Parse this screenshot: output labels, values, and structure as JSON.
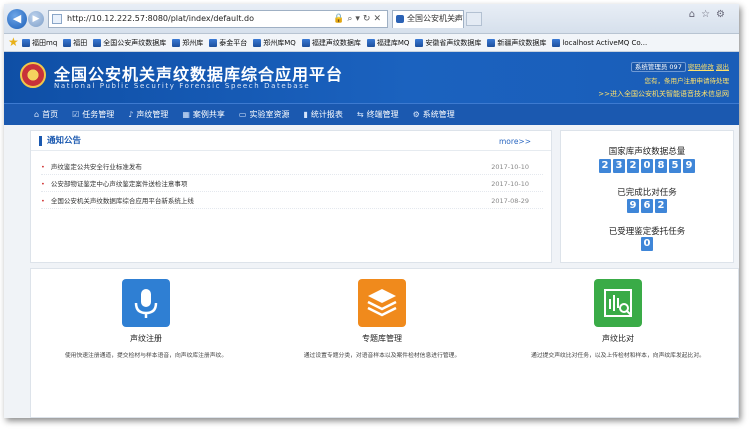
{
  "browser": {
    "url": "http://10.12.222.57:8080/plat/index/default.do",
    "tab_title": "全国公安机关声纹...",
    "favorites": [
      "福田mq",
      "福田",
      "全国公安声纹数据库",
      "郑州库",
      "泰金平台",
      "郑州库MQ",
      "福建声纹数据库",
      "福建库MQ",
      "安徽省声纹数据库",
      "新疆声纹数据库",
      "localhost ActiveMQ Co..."
    ]
  },
  "site": {
    "title": "全国公安机关声纹数据库综合应用平台",
    "subtitle": "National Public Security Forensic Speech Datebase",
    "user": {
      "name": "系统管理员 097",
      "change_password": "密码修改",
      "logout": "退出",
      "welcome": "您有，条用户注册申请待处理",
      "entry": ">>进入全国公安机关智能语音技术信息网"
    }
  },
  "nav": {
    "items": [
      {
        "icon": "⌂",
        "label": "首页"
      },
      {
        "icon": "☑",
        "label": "任务管理"
      },
      {
        "icon": "♪",
        "label": "声纹管理"
      },
      {
        "icon": "▦",
        "label": "案例共享"
      },
      {
        "icon": "▭",
        "label": "实验室资源"
      },
      {
        "icon": "▮",
        "label": "统计报表"
      },
      {
        "icon": "⇆",
        "label": "终端管理"
      },
      {
        "icon": "⚙",
        "label": "系统管理"
      }
    ]
  },
  "notice": {
    "title": "通知公告",
    "more": "more>>",
    "rows": [
      {
        "text": "声纹鉴定公共安全行业标准发布",
        "date": "2017-10-10"
      },
      {
        "text": "公安部物证鉴定中心声纹鉴定案件送检注意事项",
        "date": "2017-10-10"
      },
      {
        "text": "全国公安机关声纹数据库综合应用平台新系统上线",
        "date": "2017-08-29"
      }
    ]
  },
  "stats": {
    "total_label": "国家库声纹数据总量",
    "total_digits": [
      "2",
      "3",
      "2",
      "0",
      "8",
      "5",
      "9"
    ],
    "compare_label": "已完成比对任务",
    "compare_digits": [
      "9",
      "6",
      "2"
    ],
    "appraisal_label": "已受理鉴定委托任务",
    "appraisal_digits": [
      "0"
    ]
  },
  "apps": {
    "items": [
      {
        "name": "声纹注册",
        "desc": "使用快速注册通道，提交检材与样本语音，向声纹库注册声纹。",
        "color": "#2f7fd3"
      },
      {
        "name": "专题库管理",
        "desc": "通过设置专题分类，对语音样本以及案件检材信息进行管理。",
        "color": "#f08a1c"
      },
      {
        "name": "声纹比对",
        "desc": "通过提交声纹比对任务，以及上传检材和样本，向声纹库发起比对。",
        "color": "#3aab47"
      }
    ]
  }
}
